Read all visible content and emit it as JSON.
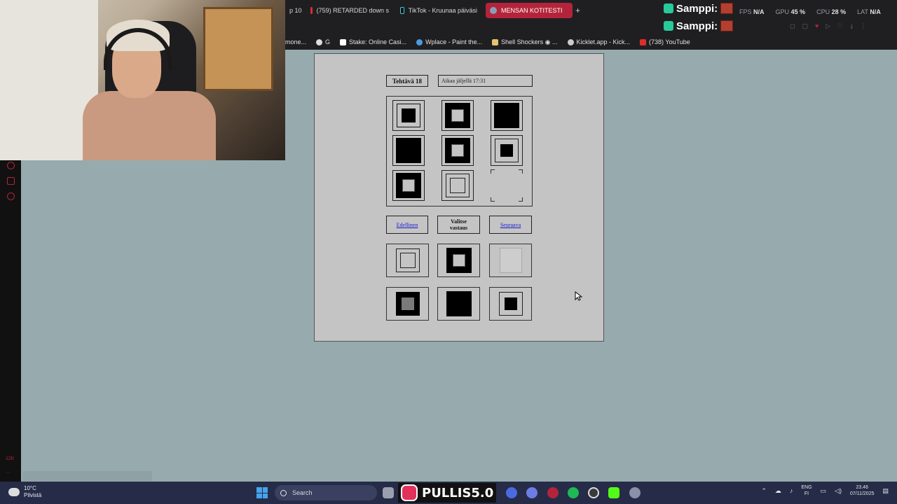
{
  "tabs": [
    {
      "label": "p 10"
    },
    {
      "label": "(759) RETARDED down s"
    },
    {
      "label": "TikTok - Kruunaa päiväsi"
    },
    {
      "label": "MENSAN KOTITESTI",
      "active": true
    }
  ],
  "overlay": {
    "user1": "Samppi:",
    "user2": "Samppi:",
    "fps_label": "FPS",
    "fps_value": "N/A",
    "gpu_label": "GPU",
    "gpu_value": "45 %",
    "cpu_label": "CPU",
    "cpu_value": "28 %",
    "lat_label": "LAT",
    "lat_value": "N/A"
  },
  "bookmarks": [
    {
      "label": "mone..."
    },
    {
      "label": "G"
    },
    {
      "label": "Stake: Online Casi..."
    },
    {
      "label": "Wplace - Paint the..."
    },
    {
      "label": "Shell Shockers ◉ ..."
    },
    {
      "label": "Kicklet.app - Kick..."
    },
    {
      "label": "(738) YouTube"
    }
  ],
  "test": {
    "task_label": "Tehtävä 18",
    "timer_text": "Aikaa jäljellä 17:31",
    "prev_label": "Edellinen",
    "choose_label_1": "Valitse",
    "choose_label_2": "vastaus",
    "next_label": "Seuraava",
    "matrix": [
      "nested-small",
      "thick-light",
      "solid",
      "solid",
      "thick-light",
      "frame-small-black",
      "thick-light",
      "thin-thin",
      "missing"
    ],
    "answers": [
      "thin-thin",
      "thick-light",
      "light",
      "gray-inner",
      "solid",
      "frame-small-black"
    ]
  },
  "sidebar": {
    "bottom_label": "12K"
  },
  "taskbar": {
    "temperature": "10°C",
    "weather_desc": "Pilvistä",
    "search_placeholder": "Search",
    "pulli_text": "PULLIS5.0",
    "lang_1": "ENG",
    "lang_2": "FI",
    "time": "23.46",
    "date": "07/11/2025"
  }
}
